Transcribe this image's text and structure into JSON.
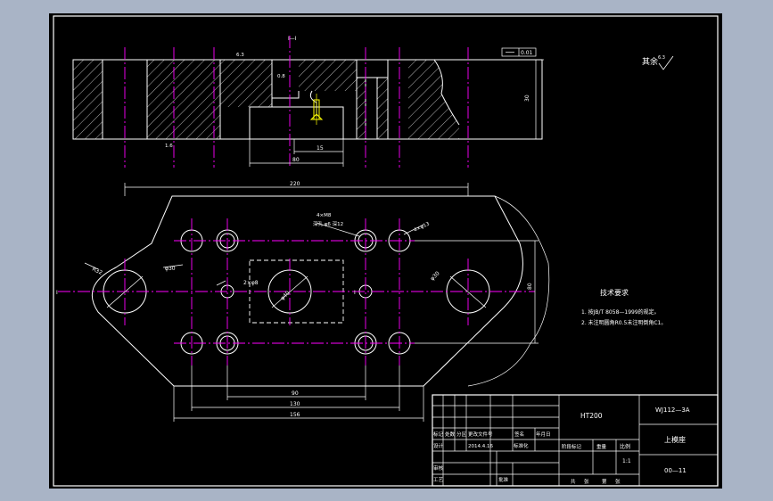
{
  "drawing": {
    "top_note": "I—I",
    "flatness_tol": "0.01",
    "roughness_top": "6.3",
    "other_roughness": "其余",
    "other_roughness_value": "6.3",
    "section_dims": {
      "height": "30",
      "width": "80",
      "offset": "15",
      "label_r": "0.8",
      "label_ra": "1.6"
    },
    "plan_dims": {
      "overall": "220",
      "d1": "90",
      "d2": "130",
      "d3": "156",
      "height": "80",
      "radius_left": "R32",
      "hole_left": "φ30",
      "hole_center": "φ40",
      "hole_right": "φ30",
      "pin_note": "2×φ8",
      "tap_note_1": "4×M8",
      "tap_note_2": "深孔 φ6 深12",
      "csk_note": "4×φ13",
      "label_i_left": "I",
      "label_i_right": "I"
    },
    "tech_req": {
      "title": "技术要求",
      "lines": [
        "1. 按JB/T 8058—1999的规定。",
        "2. 未注明圆角R0.5未注明倒角C1。"
      ]
    }
  },
  "title_block": {
    "material": "HT200",
    "drawing_no": "WJ112—3A",
    "part_name": "上模座",
    "scale_label": "比例",
    "scale_value": "1:1",
    "sheet": "00—11",
    "headers_row1": [
      "标记",
      "处数",
      "分区",
      "更改文件号",
      "签名",
      "年月日"
    ],
    "headers_row2": [
      "设计",
      "标准化",
      "阶段标记",
      "重量",
      "比例"
    ],
    "designer_date": "2014.4.16",
    "label_review": "审核",
    "label_process": "工艺",
    "label_approve": "批准",
    "footer": [
      "共",
      "张",
      "第",
      "张"
    ]
  }
}
